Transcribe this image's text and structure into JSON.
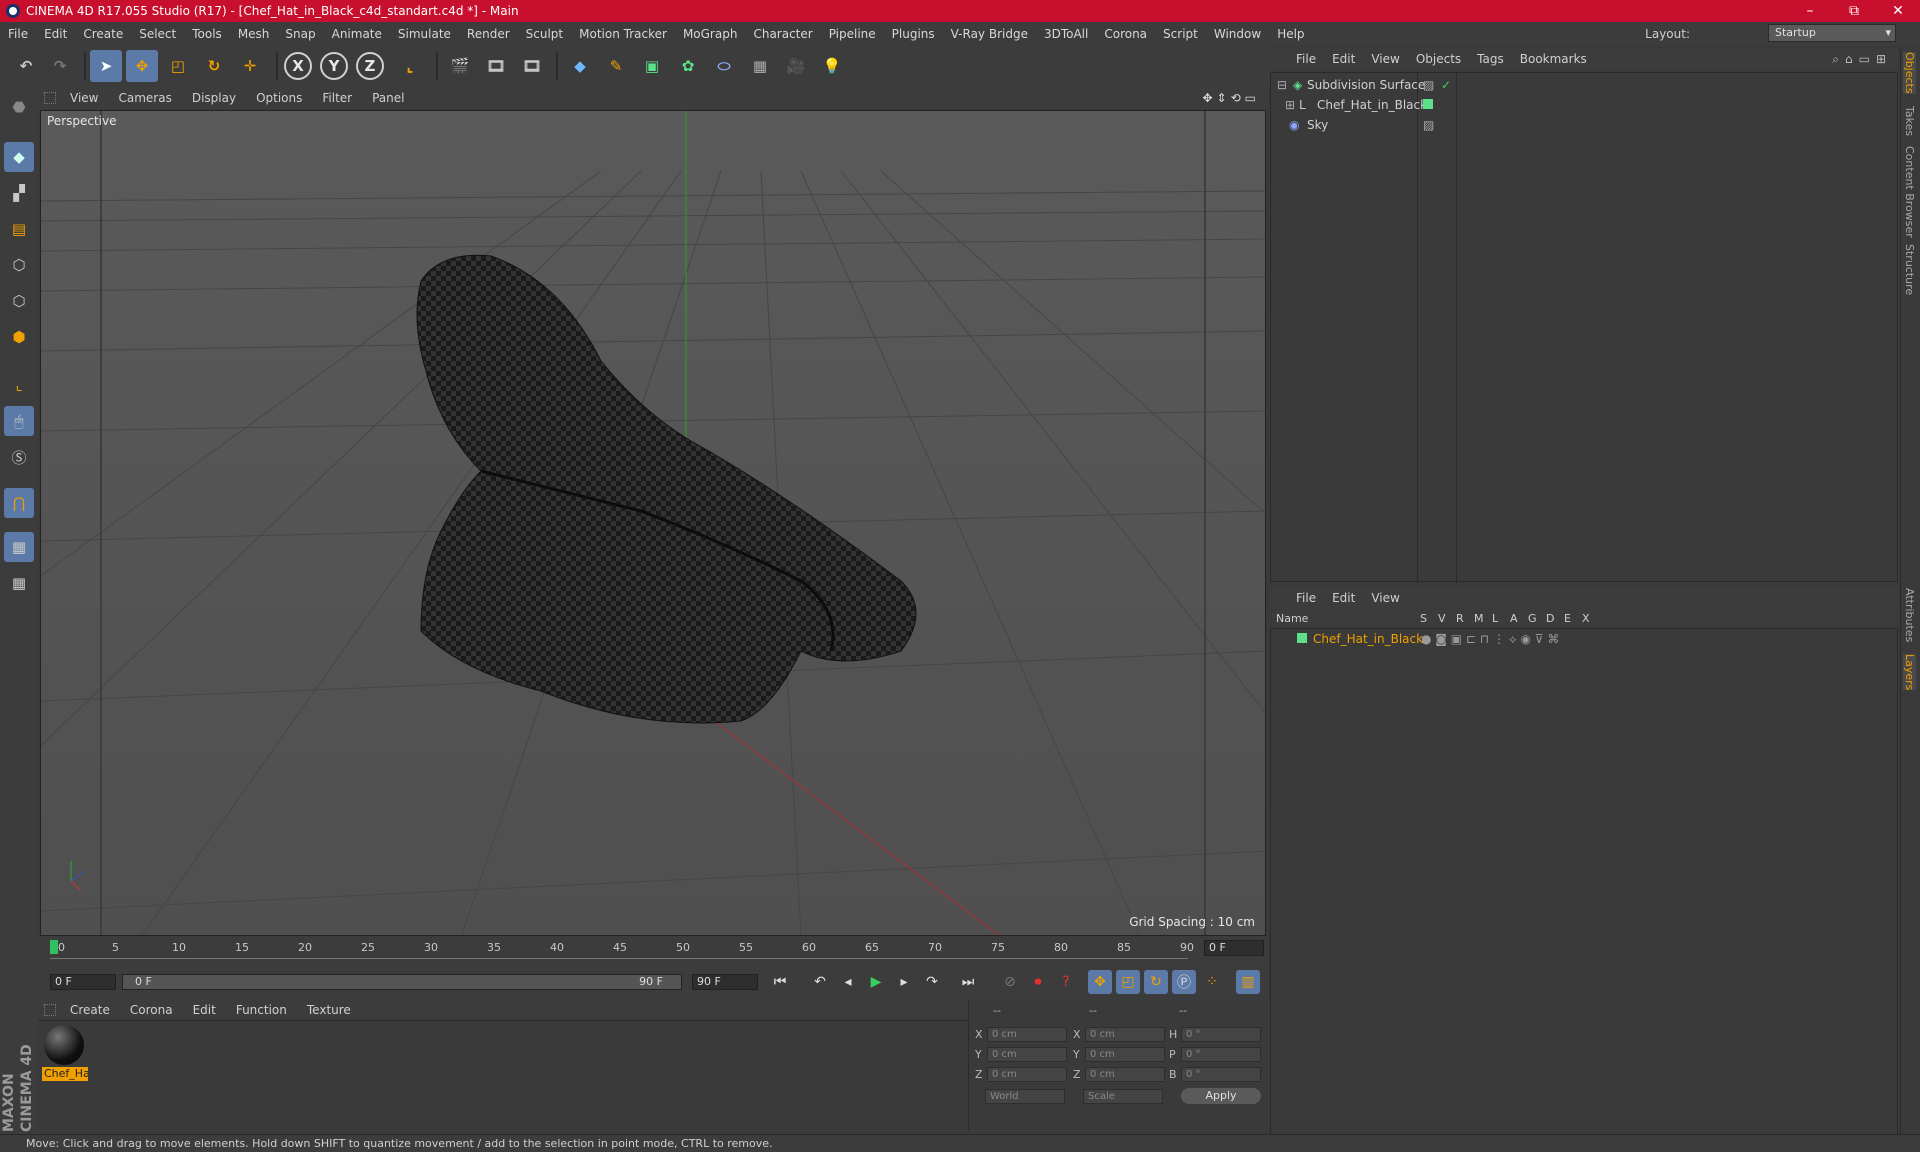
{
  "window": {
    "title": "CINEMA 4D R17.055 Studio (R17) - [Chef_Hat_in_Black_c4d_standart.c4d *] - Main",
    "controls": [
      "–",
      "⧉",
      "✕"
    ]
  },
  "menubar": [
    "File",
    "Edit",
    "Create",
    "Select",
    "Tools",
    "Mesh",
    "Snap",
    "Animate",
    "Simulate",
    "Render",
    "Sculpt",
    "Motion Tracker",
    "MoGraph",
    "Character",
    "Pipeline",
    "Plugins",
    "V-Ray Bridge",
    "3DToAll",
    "Corona",
    "Script",
    "Window",
    "Help"
  ],
  "layout": {
    "label": "Layout:",
    "value": "Startup"
  },
  "toolbar": {
    "axes": [
      "X",
      "Y",
      "Z"
    ]
  },
  "viewport": {
    "menu": [
      "View",
      "Cameras",
      "Display",
      "Options",
      "Filter",
      "Panel"
    ],
    "label": "Perspective",
    "grid_spacing": "Grid Spacing : 10 cm"
  },
  "timeline": {
    "ticks": [
      "0",
      "5",
      "10",
      "15",
      "20",
      "25",
      "30",
      "35",
      "40",
      "45",
      "50",
      "55",
      "60",
      "65",
      "70",
      "75",
      "80",
      "85",
      "90"
    ],
    "current_frame": "0 F",
    "start": "0 F",
    "range_start": "0 F",
    "range_end": "90 F",
    "end": "90 F"
  },
  "material": {
    "menu": [
      "Create",
      "Corona",
      "Edit",
      "Function",
      "Texture"
    ],
    "item": "Chef_Ha"
  },
  "coords": {
    "hdr": [
      "--",
      "--",
      "--"
    ],
    "rows": [
      {
        "a": "X",
        "v1": "0 cm",
        "b": "X",
        "v2": "0 cm",
        "c": "H",
        "v3": "0 °"
      },
      {
        "a": "Y",
        "v1": "0 cm",
        "b": "Y",
        "v2": "0 cm",
        "c": "P",
        "v3": "0 °"
      },
      {
        "a": "Z",
        "v1": "0 cm",
        "b": "Z",
        "v2": "0 cm",
        "c": "B",
        "v3": "0 °"
      }
    ],
    "world": "World",
    "scale": "Scale",
    "apply": "Apply"
  },
  "objects": {
    "menu": [
      "File",
      "Edit",
      "View",
      "Objects",
      "Tags",
      "Bookmarks"
    ],
    "items": [
      "Subdivision Surface",
      "Chef_Hat_in_Black",
      "Sky"
    ]
  },
  "layers": {
    "menu": [
      "File",
      "Edit",
      "View"
    ],
    "headers": [
      "Name",
      "S",
      "V",
      "R",
      "M",
      "L",
      "A",
      "G",
      "D",
      "E",
      "X"
    ],
    "item": "Chef_Hat_in_Black"
  },
  "right_tabs": [
    "Objects",
    "Takes",
    "Content Browser",
    "Structure",
    "Attributes",
    "Layers"
  ],
  "brand": "MAXON CINEMA 4D",
  "status": "Move: Click and drag to move elements. Hold down SHIFT to quantize movement / add to the selection in point mode, CTRL to remove.",
  "colors": {
    "title_red": "#c8102e",
    "accent_blue": "#5b7aa8",
    "highlight_orange": "#f0a000"
  }
}
